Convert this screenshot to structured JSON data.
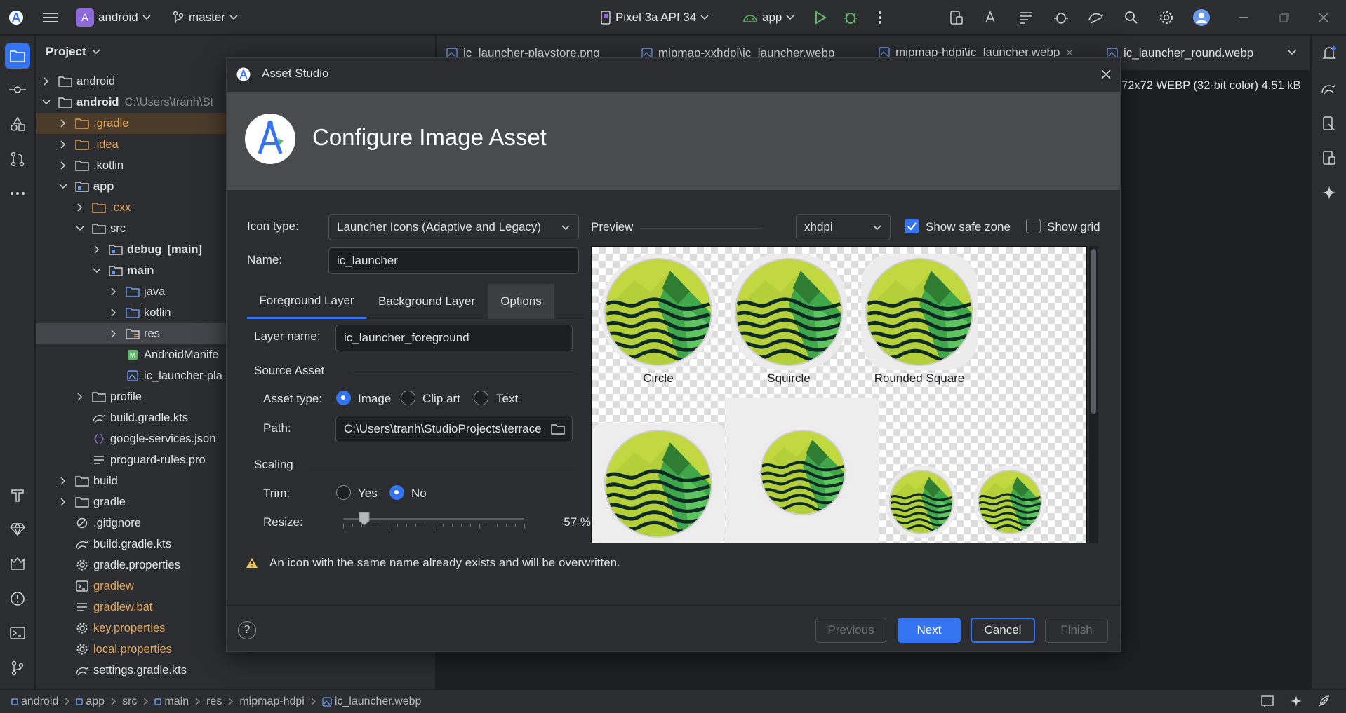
{
  "titlebar": {
    "project_badge": "A",
    "project_name": "android",
    "branch": "master",
    "device": "Pixel 3a API 34",
    "run_config": "app"
  },
  "project_panel": {
    "title": "Project",
    "rows": [
      {
        "label": "android",
        "extra": ""
      },
      {
        "label": "android",
        "extra": "C:\\Users\\tranh\\St"
      },
      {
        "label": ".gradle",
        "extra": ""
      },
      {
        "label": ".idea",
        "extra": ""
      },
      {
        "label": ".kotlin",
        "extra": ""
      },
      {
        "label": "app",
        "extra": ""
      },
      {
        "label": ".cxx",
        "extra": ""
      },
      {
        "label": "src",
        "extra": ""
      },
      {
        "label": "debug",
        "extra": "[main]"
      },
      {
        "label": "main",
        "extra": ""
      },
      {
        "label": "java",
        "extra": ""
      },
      {
        "label": "kotlin",
        "extra": ""
      },
      {
        "label": "res",
        "extra": ""
      },
      {
        "label": "AndroidManife",
        "extra": ""
      },
      {
        "label": "ic_launcher-pla",
        "extra": ""
      },
      {
        "label": "profile",
        "extra": ""
      },
      {
        "label": "build.gradle.kts",
        "extra": ""
      },
      {
        "label": "google-services.json",
        "extra": ""
      },
      {
        "label": "proguard-rules.pro",
        "extra": ""
      },
      {
        "label": "build",
        "extra": ""
      },
      {
        "label": "gradle",
        "extra": ""
      },
      {
        "label": ".gitignore",
        "extra": ""
      },
      {
        "label": "build.gradle.kts",
        "extra": ""
      },
      {
        "label": "gradle.properties",
        "extra": ""
      },
      {
        "label": "gradlew",
        "extra": ""
      },
      {
        "label": "gradlew.bat",
        "extra": ""
      },
      {
        "label": "key.properties",
        "extra": ""
      },
      {
        "label": "local.properties",
        "extra": ""
      },
      {
        "label": "settings.gradle.kts",
        "extra": ""
      }
    ]
  },
  "editor": {
    "tabs": [
      "ic_launcher-playstore.png",
      "mipmap-xxhdpi\\ic_launcher.webp",
      "mipmap-hdpi\\ic_launcher.webp",
      "ic_launcher_round.webp"
    ],
    "image_info": "72x72 WEBP (32-bit color) 4.51 kB"
  },
  "dialog": {
    "title": "Asset Studio",
    "heading": "Configure Image Asset",
    "icon_type_label": "Icon type:",
    "icon_type_value": "Launcher Icons (Adaptive and Legacy)",
    "name_label": "Name:",
    "name_value": "ic_launcher",
    "tabs": [
      "Foreground Layer",
      "Background Layer",
      "Options"
    ],
    "layer_name_label": "Layer name:",
    "layer_name_value": "ic_launcher_foreground",
    "source_asset": "Source Asset",
    "asset_type_label": "Asset type:",
    "asset_types": [
      "Image",
      "Clip art",
      "Text"
    ],
    "path_label": "Path:",
    "path_value": "C:\\Users\\tranh\\StudioProjects\\terrace",
    "scaling": "Scaling",
    "trim_label": "Trim:",
    "trim_yes": "Yes",
    "trim_no": "No",
    "resize_label": "Resize:",
    "resize_value": "57 %",
    "resize_fraction": 0.57,
    "preview_label": "Preview",
    "density": "xhdpi",
    "show_safe_zone": "Show safe zone",
    "show_grid": "Show grid",
    "preview_shapes": [
      "Circle",
      "Squircle",
      "Rounded Square"
    ],
    "warning": "An icon with the same name already exists and will be overwritten.",
    "help": "?",
    "previous": "Previous",
    "next": "Next",
    "cancel": "Cancel",
    "finish": "Finish"
  },
  "statusbar": {
    "crumbs": [
      "android",
      "app",
      "src",
      "main",
      "res",
      "mipmap-hdpi",
      "ic_launcher.webp"
    ]
  }
}
